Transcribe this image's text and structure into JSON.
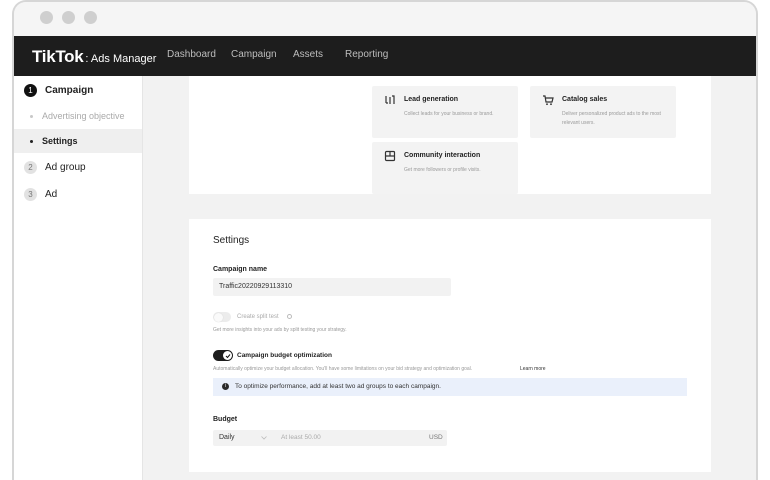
{
  "topnav": {
    "brand": "TikTok",
    "brand_sub": ": Ads Manager",
    "items": [
      "Dashboard",
      "Campaign",
      "Assets",
      "Reporting"
    ]
  },
  "sidebar": {
    "campaign": {
      "num": "1",
      "label": "Campaign"
    },
    "advertising_objective": "Advertising objective",
    "settings": "Settings",
    "ad_group": {
      "num": "2",
      "label": "Ad group"
    },
    "ad": {
      "num": "3",
      "label": "Ad"
    }
  },
  "objectives": {
    "lead": {
      "title": "Lead generation",
      "desc": "Collect leads for your business or brand.",
      "icon": "funnel-icon"
    },
    "catalog": {
      "title": "Catalog sales",
      "desc": "Deliver personalized product ads to the most relevant users.",
      "icon": "cart-icon"
    },
    "community": {
      "title": "Community interaction",
      "desc": "Get more followers or profile visits.",
      "icon": "community-icon"
    }
  },
  "settings": {
    "heading": "Settings",
    "campaign_name_label": "Campaign name",
    "campaign_name_value": "Traffic20220929113310",
    "split_test_label": "Create split test",
    "split_test_desc": "Get more insights into your ads by split testing your strategy.",
    "cbo_label": "Campaign budget optimization",
    "cbo_desc": "Automatically optimize your budget allocation. You'll have some limitations on your bid strategy and optimization goal.",
    "learn_more": "Learn more",
    "info_text": "To optimize performance, add at least two ad groups to each campaign.",
    "budget_label": "Budget",
    "budget_type": "Daily",
    "budget_placeholder": "At least 50.00",
    "currency": "USD"
  },
  "colors": {
    "nav_bg": "#1d1d1d",
    "info_bg": "#eaf0fb",
    "accent_dark": "#111111"
  }
}
